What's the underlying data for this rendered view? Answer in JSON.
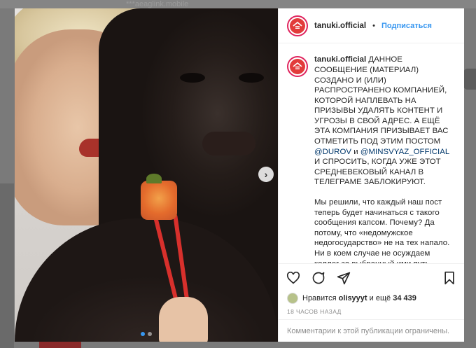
{
  "backdrop": {
    "top_text": "***aeaglink.mobile"
  },
  "post": {
    "media": {
      "slide_count": 2,
      "current_slide": 1,
      "next_glyph": "›"
    },
    "header": {
      "username": "tanuki.official",
      "separator": "•",
      "follow_label": "Подписаться"
    },
    "caption": {
      "username": "tanuki.official",
      "part1": "ДАННОЕ СООБЩЕНИЕ (МАТЕРИАЛ) СОЗДАНО И (ИЛИ) РАСПРОСТРАНЕНО КОМПАНИЕЙ, КОТОРОЙ НАПЛЕВАТЬ НА ПРИЗЫВЫ УДАЛЯТЬ КОНТЕНТ И УГРОЗЫ В СВОЙ АДРЕС. А ЕЩЁ ЭТА КОМПАНИЯ ПРИЗЫВАЕТ ВАС ОТМЕТИТЬ ПОД ЭТИМ ПОСТОМ",
      "mention1": "@DUROV",
      "conj": "и",
      "mention2": "@MINSVYAZ_OFFICIAL",
      "part2": "И СПРОСИТЬ, КОГДА УЖЕ ЭТОТ СРЕДНЕВЕКОВЫЙ КАНАЛ В ТЕЛЕГРАМЕ ЗАБЛОКИРУЮТ.",
      "paragraph2": "Мы решили, что каждый наш пост теперь будет начинаться с такого сообщения капсом. Почему? Да потому, что «недомужское недогосударство» не на тех напало. Ни в коем случае не осуждаем коллег за выбранный ими путь"
    },
    "actions": {
      "like_icon": "heart-icon",
      "comment_icon": "comment-icon",
      "share_icon": "paper-plane-icon",
      "save_icon": "bookmark-icon"
    },
    "likes": {
      "prefix": "Нравится",
      "user": "olisyyyt",
      "middle": "и ещё",
      "count": "34 439"
    },
    "timestamp": "18 ЧАСОВ НАЗАД",
    "comments_disabled": "Комментарии к этой публикации ограничены.",
    "colors": {
      "accent_blue": "#3897f0",
      "brand_red": "#e23b3b",
      "text": "#262626",
      "muted": "#8e8e8e"
    }
  }
}
